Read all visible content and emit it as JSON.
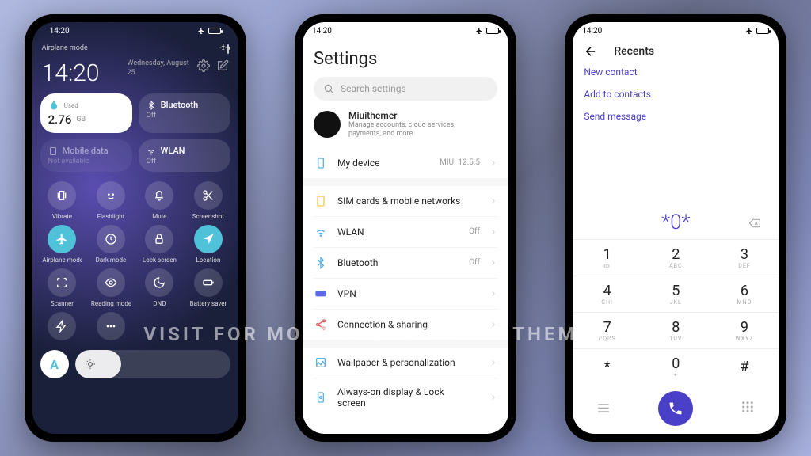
{
  "watermark": "VISIT FOR MORE THEMES - MIUITHEMER.COM",
  "status_time": "14:20",
  "cc": {
    "airplane_label": "Airplane mode",
    "time": "14:20",
    "date_line1": "Wednesday, August",
    "date_line2": "25",
    "data_tile": {
      "value": "2.76",
      "unit": "GB",
      "small": "Used"
    },
    "bt": {
      "title": "Bluetooth",
      "sub": "Off"
    },
    "mobile": {
      "title": "Mobile data",
      "sub": "Not available"
    },
    "wlan": {
      "title": "WLAN",
      "sub": "Off"
    },
    "toggles": [
      {
        "label": "Vibrate",
        "on": false,
        "icon": "vibrate"
      },
      {
        "label": "Flashlight",
        "on": false,
        "icon": "flash"
      },
      {
        "label": "Mute",
        "on": false,
        "icon": "bell"
      },
      {
        "label": "Screenshot",
        "on": false,
        "icon": "scissors"
      },
      {
        "label": "Airplane mode",
        "on": true,
        "icon": "plane"
      },
      {
        "label": "Dark mode",
        "on": false,
        "icon": "clock"
      },
      {
        "label": "Lock screen",
        "on": false,
        "icon": "lock"
      },
      {
        "label": "Location",
        "on": true,
        "icon": "nav"
      },
      {
        "label": "Scanner",
        "on": false,
        "icon": "scan"
      },
      {
        "label": "Reading mode",
        "on": false,
        "icon": "eye"
      },
      {
        "label": "DND",
        "on": false,
        "icon": "moon"
      },
      {
        "label": "Battery saver",
        "on": false,
        "icon": "batt"
      },
      {
        "label": "",
        "on": false,
        "icon": "bolt"
      },
      {
        "label": "",
        "on": false,
        "icon": "dots"
      }
    ],
    "auto_label": "A"
  },
  "settings": {
    "title": "Settings",
    "search_placeholder": "Search settings",
    "account": {
      "name": "Miuithemer",
      "desc": "Manage accounts, cloud services, payments, and more"
    },
    "items_a": [
      {
        "icon": "phone",
        "color": "#5bb1e8",
        "label": "My device",
        "value": "MIUI 12.5.5"
      }
    ],
    "items_b": [
      {
        "icon": "sim",
        "color": "#f8c64b",
        "label": "SIM cards & mobile networks",
        "value": ""
      },
      {
        "icon": "wifi",
        "color": "#5bb1e8",
        "label": "WLAN",
        "value": "Off"
      },
      {
        "icon": "bt",
        "color": "#5bb1e8",
        "label": "Bluetooth",
        "value": "Off"
      },
      {
        "icon": "vpn",
        "color": "#5b6be8",
        "label": "VPN",
        "value": ""
      },
      {
        "icon": "share",
        "color": "#e85b5b",
        "label": "Connection & sharing",
        "value": ""
      }
    ],
    "items_c": [
      {
        "icon": "wall",
        "color": "#5bb1e8",
        "label": "Wallpaper & personalization",
        "value": ""
      },
      {
        "icon": "aod",
        "color": "#5bb1e8",
        "label": "Always-on display & Lock screen",
        "value": ""
      }
    ]
  },
  "dialer": {
    "title": "Recents",
    "links": [
      "New contact",
      "Add to contacts",
      "Send message"
    ],
    "display": "*0*",
    "keys": [
      {
        "n": "1",
        "l": "∞"
      },
      {
        "n": "2",
        "l": "ABC"
      },
      {
        "n": "3",
        "l": "DEF"
      },
      {
        "n": "4",
        "l": "GHI"
      },
      {
        "n": "5",
        "l": "JKL"
      },
      {
        "n": "6",
        "l": "MNO"
      },
      {
        "n": "7",
        "l": "PQRS"
      },
      {
        "n": "8",
        "l": "TUV"
      },
      {
        "n": "9",
        "l": "WXYZ"
      },
      {
        "n": "*",
        "l": ""
      },
      {
        "n": "0",
        "l": "+"
      },
      {
        "n": "#",
        "l": ""
      }
    ]
  }
}
